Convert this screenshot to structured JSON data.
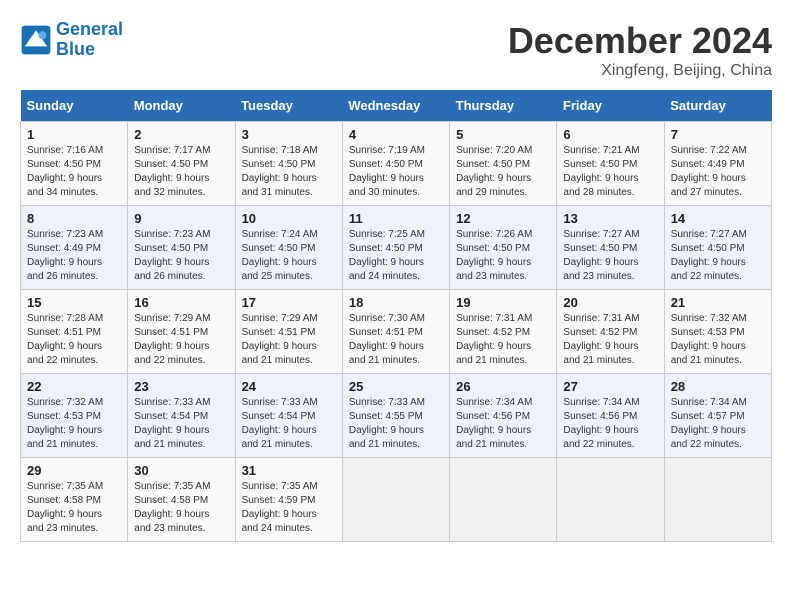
{
  "header": {
    "logo_line1": "General",
    "logo_line2": "Blue",
    "title": "December 2024",
    "subtitle": "Xingfeng, Beijing, China"
  },
  "calendar": {
    "days_of_week": [
      "Sunday",
      "Monday",
      "Tuesday",
      "Wednesday",
      "Thursday",
      "Friday",
      "Saturday"
    ],
    "weeks": [
      [
        {
          "day": "1",
          "detail": "Sunrise: 7:16 AM\nSunset: 4:50 PM\nDaylight: 9 hours\nand 34 minutes."
        },
        {
          "day": "2",
          "detail": "Sunrise: 7:17 AM\nSunset: 4:50 PM\nDaylight: 9 hours\nand 32 minutes."
        },
        {
          "day": "3",
          "detail": "Sunrise: 7:18 AM\nSunset: 4:50 PM\nDaylight: 9 hours\nand 31 minutes."
        },
        {
          "day": "4",
          "detail": "Sunrise: 7:19 AM\nSunset: 4:50 PM\nDaylight: 9 hours\nand 30 minutes."
        },
        {
          "day": "5",
          "detail": "Sunrise: 7:20 AM\nSunset: 4:50 PM\nDaylight: 9 hours\nand 29 minutes."
        },
        {
          "day": "6",
          "detail": "Sunrise: 7:21 AM\nSunset: 4:50 PM\nDaylight: 9 hours\nand 28 minutes."
        },
        {
          "day": "7",
          "detail": "Sunrise: 7:22 AM\nSunset: 4:49 PM\nDaylight: 9 hours\nand 27 minutes."
        }
      ],
      [
        {
          "day": "8",
          "detail": "Sunrise: 7:23 AM\nSunset: 4:49 PM\nDaylight: 9 hours\nand 26 minutes."
        },
        {
          "day": "9",
          "detail": "Sunrise: 7:23 AM\nSunset: 4:50 PM\nDaylight: 9 hours\nand 26 minutes."
        },
        {
          "day": "10",
          "detail": "Sunrise: 7:24 AM\nSunset: 4:50 PM\nDaylight: 9 hours\nand 25 minutes."
        },
        {
          "day": "11",
          "detail": "Sunrise: 7:25 AM\nSunset: 4:50 PM\nDaylight: 9 hours\nand 24 minutes."
        },
        {
          "day": "12",
          "detail": "Sunrise: 7:26 AM\nSunset: 4:50 PM\nDaylight: 9 hours\nand 23 minutes."
        },
        {
          "day": "13",
          "detail": "Sunrise: 7:27 AM\nSunset: 4:50 PM\nDaylight: 9 hours\nand 23 minutes."
        },
        {
          "day": "14",
          "detail": "Sunrise: 7:27 AM\nSunset: 4:50 PM\nDaylight: 9 hours\nand 22 minutes."
        }
      ],
      [
        {
          "day": "15",
          "detail": "Sunrise: 7:28 AM\nSunset: 4:51 PM\nDaylight: 9 hours\nand 22 minutes."
        },
        {
          "day": "16",
          "detail": "Sunrise: 7:29 AM\nSunset: 4:51 PM\nDaylight: 9 hours\nand 22 minutes."
        },
        {
          "day": "17",
          "detail": "Sunrise: 7:29 AM\nSunset: 4:51 PM\nDaylight: 9 hours\nand 21 minutes."
        },
        {
          "day": "18",
          "detail": "Sunrise: 7:30 AM\nSunset: 4:51 PM\nDaylight: 9 hours\nand 21 minutes."
        },
        {
          "day": "19",
          "detail": "Sunrise: 7:31 AM\nSunset: 4:52 PM\nDaylight: 9 hours\nand 21 minutes."
        },
        {
          "day": "20",
          "detail": "Sunrise: 7:31 AM\nSunset: 4:52 PM\nDaylight: 9 hours\nand 21 minutes."
        },
        {
          "day": "21",
          "detail": "Sunrise: 7:32 AM\nSunset: 4:53 PM\nDaylight: 9 hours\nand 21 minutes."
        }
      ],
      [
        {
          "day": "22",
          "detail": "Sunrise: 7:32 AM\nSunset: 4:53 PM\nDaylight: 9 hours\nand 21 minutes."
        },
        {
          "day": "23",
          "detail": "Sunrise: 7:33 AM\nSunset: 4:54 PM\nDaylight: 9 hours\nand 21 minutes."
        },
        {
          "day": "24",
          "detail": "Sunrise: 7:33 AM\nSunset: 4:54 PM\nDaylight: 9 hours\nand 21 minutes."
        },
        {
          "day": "25",
          "detail": "Sunrise: 7:33 AM\nSunset: 4:55 PM\nDaylight: 9 hours\nand 21 minutes."
        },
        {
          "day": "26",
          "detail": "Sunrise: 7:34 AM\nSunset: 4:56 PM\nDaylight: 9 hours\nand 21 minutes."
        },
        {
          "day": "27",
          "detail": "Sunrise: 7:34 AM\nSunset: 4:56 PM\nDaylight: 9 hours\nand 22 minutes."
        },
        {
          "day": "28",
          "detail": "Sunrise: 7:34 AM\nSunset: 4:57 PM\nDaylight: 9 hours\nand 22 minutes."
        }
      ],
      [
        {
          "day": "29",
          "detail": "Sunrise: 7:35 AM\nSunset: 4:58 PM\nDaylight: 9 hours\nand 23 minutes."
        },
        {
          "day": "30",
          "detail": "Sunrise: 7:35 AM\nSunset: 4:58 PM\nDaylight: 9 hours\nand 23 minutes."
        },
        {
          "day": "31",
          "detail": "Sunrise: 7:35 AM\nSunset: 4:59 PM\nDaylight: 9 hours\nand 24 minutes."
        },
        {
          "day": "",
          "detail": ""
        },
        {
          "day": "",
          "detail": ""
        },
        {
          "day": "",
          "detail": ""
        },
        {
          "day": "",
          "detail": ""
        }
      ]
    ]
  }
}
